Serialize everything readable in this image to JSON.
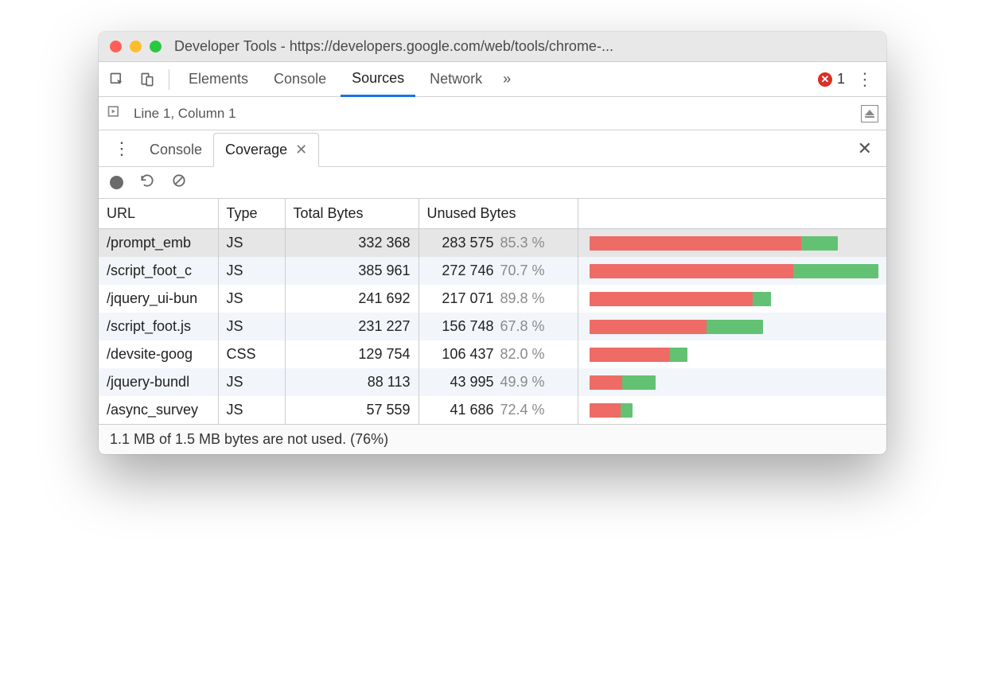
{
  "window": {
    "title": "Developer Tools - https://developers.google.com/web/tools/chrome-..."
  },
  "tabs": {
    "elements": "Elements",
    "console": "Console",
    "sources": "Sources",
    "network": "Network"
  },
  "errors": {
    "count": "1"
  },
  "cursor": "Line 1, Column 1",
  "drawer": {
    "console": "Console",
    "coverage": "Coverage"
  },
  "columns": {
    "url": "URL",
    "type": "Type",
    "total": "Total Bytes",
    "unused": "Unused Bytes"
  },
  "rows": [
    {
      "url": "/prompt_emb",
      "type": "JS",
      "total": "332 368",
      "unused": "283 575",
      "pct": "85.3 %",
      "barTotalPct": 86,
      "barUnusedPct": 85.3,
      "selected": true
    },
    {
      "url": "/script_foot_c",
      "type": "JS",
      "total": "385 961",
      "unused": "272 746",
      "pct": "70.7 %",
      "barTotalPct": 100,
      "barUnusedPct": 70.7
    },
    {
      "url": "/jquery_ui-bun",
      "type": "JS",
      "total": "241 692",
      "unused": "217 071",
      "pct": "89.8 %",
      "barTotalPct": 63,
      "barUnusedPct": 89.8
    },
    {
      "url": "/script_foot.js",
      "type": "JS",
      "total": "231 227",
      "unused": "156 748",
      "pct": "67.8 %",
      "barTotalPct": 60,
      "barUnusedPct": 67.8
    },
    {
      "url": "/devsite-goog",
      "type": "CSS",
      "total": "129 754",
      "unused": "106 437",
      "pct": "82.0 %",
      "barTotalPct": 34,
      "barUnusedPct": 82.0
    },
    {
      "url": "/jquery-bundl",
      "type": "JS",
      "total": "88 113",
      "unused": "43 995",
      "pct": "49.9 %",
      "barTotalPct": 23,
      "barUnusedPct": 49.9
    },
    {
      "url": "/async_survey",
      "type": "JS",
      "total": "57 559",
      "unused": "41 686",
      "pct": "72.4 %",
      "barTotalPct": 15,
      "barUnusedPct": 72.4
    }
  ],
  "status": "1.1 MB of 1.5 MB bytes are not used. (76%)"
}
